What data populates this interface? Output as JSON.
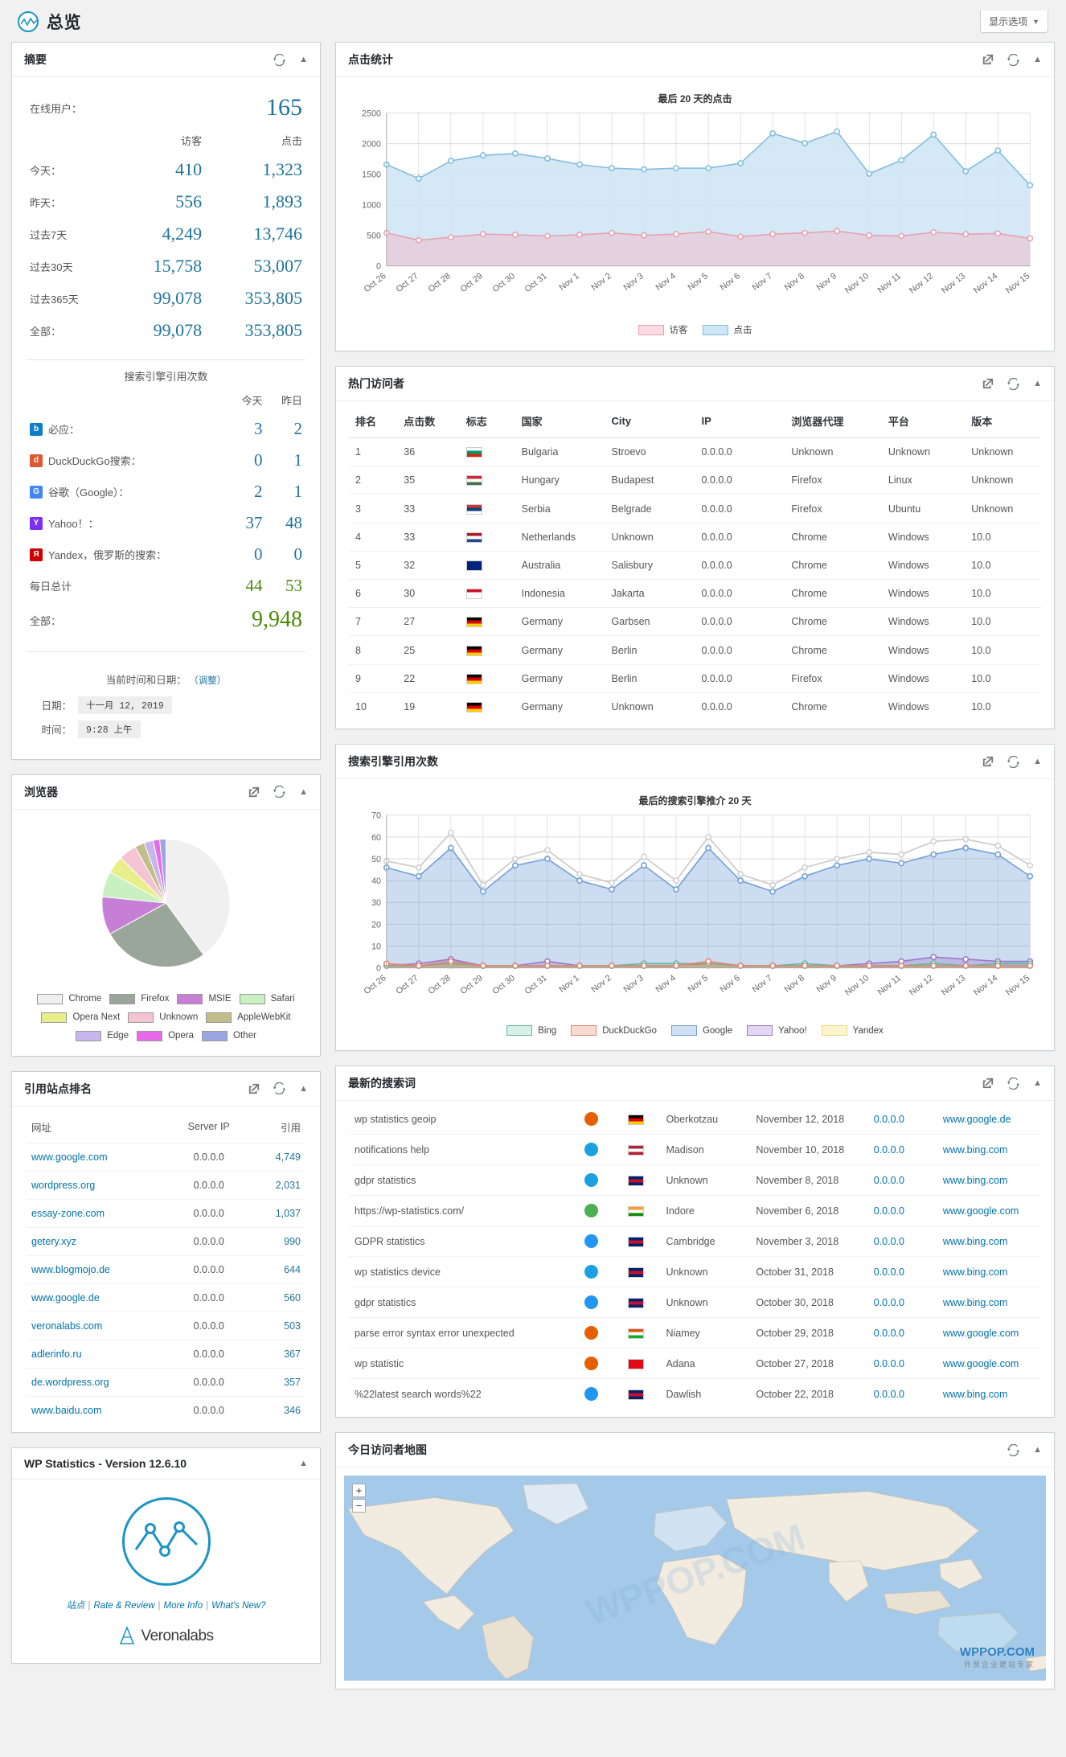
{
  "header": {
    "title": "总览",
    "screen_options": "显示选项",
    "logo_icon": "wp-statistics-logo-icon",
    "caret_icon": "chevron-down-icon"
  },
  "summary": {
    "title": "摘要",
    "refresh_icon": "refresh-icon",
    "collapse_icon": "chevron-up-icon",
    "online_label": "在线用户：",
    "online_value": "165",
    "col_visitors": "访客",
    "col_hits": "点击",
    "rows": [
      {
        "label": "今天：",
        "visitors": "410",
        "hits": "1,323"
      },
      {
        "label": "昨天：",
        "visitors": "556",
        "hits": "1,893"
      },
      {
        "label": "过去7天",
        "visitors": "4,249",
        "hits": "13,746"
      },
      {
        "label": "过去30天",
        "visitors": "15,758",
        "hits": "53,007"
      },
      {
        "label": "过去365天",
        "visitors": "99,078",
        "hits": "353,805"
      },
      {
        "label": "全部：",
        "visitors": "99,078",
        "hits": "353,805"
      }
    ],
    "search_caption": "搜索引擎引用次数",
    "se_col_today": "今天",
    "se_col_yesterday": "昨日",
    "search_engines": [
      {
        "name": "必应：",
        "icon": "bing-icon",
        "today": "3",
        "yesterday": "2"
      },
      {
        "name": "DuckDuckGo搜索：",
        "icon": "duckduckgo-icon",
        "today": "0",
        "yesterday": "1"
      },
      {
        "name": "谷歌（Google）：",
        "icon": "google-icon",
        "today": "2",
        "yesterday": "1"
      },
      {
        "name": "Yahoo！：",
        "icon": "yahoo-icon",
        "today": "37",
        "yesterday": "48"
      },
      {
        "name": "Yandex，俄罗斯的搜索：",
        "icon": "yandex-icon",
        "today": "0",
        "yesterday": "0"
      }
    ],
    "daily_total_label": "每日总计",
    "daily_total_today": "44",
    "daily_total_yesterday": "53",
    "all_label": "全部：",
    "all_value": "9,948",
    "datetime_caption": "当前时间和日期：",
    "datetime_adjust": "（调整）",
    "date_label": "日期：",
    "date_value": "十一月 12, 2019",
    "time_label": "时间：",
    "time_value": "9:28 上午"
  },
  "hits_panel": {
    "title": "点击统计",
    "external_icon": "external-link-icon",
    "refresh_icon": "refresh-icon",
    "collapse_icon": "chevron-up-icon"
  },
  "visitors_panel": {
    "title": "热门访问者",
    "external_icon": "external-link-icon",
    "refresh_icon": "refresh-icon",
    "collapse_icon": "chevron-up-icon",
    "columns": [
      "排名",
      "点击数",
      "标志",
      "国家",
      "City",
      "IP",
      "浏览器代理",
      "平台",
      "版本"
    ],
    "rows": [
      {
        "rank": "1",
        "hits": "36",
        "flag": "bg",
        "country": "Bulgaria",
        "city": "Stroevo",
        "ip": "0.0.0.0",
        "agent": "Unknown",
        "platform": "Unknown",
        "version": "Unknown"
      },
      {
        "rank": "2",
        "hits": "35",
        "flag": "hu",
        "country": "Hungary",
        "city": "Budapest",
        "ip": "0.0.0.0",
        "agent": "Firefox",
        "platform": "Linux",
        "version": "Unknown"
      },
      {
        "rank": "3",
        "hits": "33",
        "flag": "rs",
        "country": "Serbia",
        "city": "Belgrade",
        "ip": "0.0.0.0",
        "agent": "Firefox",
        "platform": "Ubuntu",
        "version": "Unknown"
      },
      {
        "rank": "4",
        "hits": "33",
        "flag": "nl",
        "country": "Netherlands",
        "city": "Unknown",
        "ip": "0.0.0.0",
        "agent": "Chrome",
        "platform": "Windows",
        "version": "10.0"
      },
      {
        "rank": "5",
        "hits": "32",
        "flag": "au",
        "country": "Australia",
        "city": "Salisbury",
        "ip": "0.0.0.0",
        "agent": "Chrome",
        "platform": "Windows",
        "version": "10.0"
      },
      {
        "rank": "6",
        "hits": "30",
        "flag": "id",
        "country": "Indonesia",
        "city": "Jakarta",
        "ip": "0.0.0.0",
        "agent": "Chrome",
        "platform": "Windows",
        "version": "10.0"
      },
      {
        "rank": "7",
        "hits": "27",
        "flag": "de",
        "country": "Germany",
        "city": "Garbsen",
        "ip": "0.0.0.0",
        "agent": "Chrome",
        "platform": "Windows",
        "version": "10.0"
      },
      {
        "rank": "8",
        "hits": "25",
        "flag": "de",
        "country": "Germany",
        "city": "Berlin",
        "ip": "0.0.0.0",
        "agent": "Chrome",
        "platform": "Windows",
        "version": "10.0"
      },
      {
        "rank": "9",
        "hits": "22",
        "flag": "de",
        "country": "Germany",
        "city": "Berlin",
        "ip": "0.0.0.0",
        "agent": "Firefox",
        "platform": "Windows",
        "version": "10.0"
      },
      {
        "rank": "10",
        "hits": "19",
        "flag": "de",
        "country": "Germany",
        "city": "Unknown",
        "ip": "0.0.0.0",
        "agent": "Chrome",
        "platform": "Windows",
        "version": "10.0"
      }
    ]
  },
  "browsers_panel": {
    "title": "浏览器",
    "external_icon": "external-link-icon",
    "refresh_icon": "refresh-icon",
    "collapse_icon": "chevron-up-icon"
  },
  "referrers_panel": {
    "title": "引用站点排名",
    "external_icon": "external-link-icon",
    "refresh_icon": "refresh-icon",
    "collapse_icon": "chevron-up-icon",
    "columns": [
      "网址",
      "Server IP",
      "引用"
    ],
    "rows": [
      {
        "site": "www.google.com",
        "ip": "0.0.0.0",
        "count": "4,749"
      },
      {
        "site": "wordpress.org",
        "ip": "0.0.0.0",
        "count": "2,031"
      },
      {
        "site": "essay-zone.com",
        "ip": "0.0.0.0",
        "count": "1,037"
      },
      {
        "site": "getery.xyz",
        "ip": "0.0.0.0",
        "count": "990"
      },
      {
        "site": "www.blogmojo.de",
        "ip": "0.0.0.0",
        "count": "644"
      },
      {
        "site": "www.google.de",
        "ip": "0.0.0.0",
        "count": "560"
      },
      {
        "site": "veronalabs.com",
        "ip": "0.0.0.0",
        "count": "503"
      },
      {
        "site": "adlerinfo.ru",
        "ip": "0.0.0.0",
        "count": "367"
      },
      {
        "site": "de.wordpress.org",
        "ip": "0.0.0.0",
        "count": "357"
      },
      {
        "site": "www.baidu.com",
        "ip": "0.0.0.0",
        "count": "346"
      }
    ]
  },
  "se_panel": {
    "title": "搜索引擎引用次数",
    "external_icon": "external-link-icon",
    "refresh_icon": "refresh-icon",
    "collapse_icon": "chevron-up-icon"
  },
  "words_panel": {
    "title": "最新的搜索词",
    "external_icon": "external-link-icon",
    "refresh_icon": "refresh-icon",
    "collapse_icon": "chevron-up-icon",
    "rows": [
      {
        "word": "wp statistics geoip",
        "browser": "firefox",
        "flag": "de",
        "city": "Oberkotzau",
        "date": "November 12, 2018",
        "ip": "0.0.0.0",
        "referrer": "www.google.de"
      },
      {
        "word": "notifications help",
        "browser": "ie",
        "flag": "us",
        "city": "Madison",
        "date": "November 10, 2018",
        "ip": "0.0.0.0",
        "referrer": "www.bing.com"
      },
      {
        "word": "gdpr statistics",
        "browser": "ie",
        "flag": "gb",
        "city": "Unknown",
        "date": "November 8, 2018",
        "ip": "0.0.0.0",
        "referrer": "www.bing.com"
      },
      {
        "word": "https://wp-statistics.com/",
        "browser": "chrome",
        "flag": "in",
        "city": "Indore",
        "date": "November 6, 2018",
        "ip": "0.0.0.0",
        "referrer": "www.google.com"
      },
      {
        "word": "GDPR statistics",
        "browser": "unknown",
        "flag": "gb",
        "city": "Cambridge",
        "date": "November 3, 2018",
        "ip": "0.0.0.0",
        "referrer": "www.bing.com"
      },
      {
        "word": "wp statistics device",
        "browser": "ie",
        "flag": "gb",
        "city": "Unknown",
        "date": "October 31, 2018",
        "ip": "0.0.0.0",
        "referrer": "www.bing.com"
      },
      {
        "word": "gdpr statistics",
        "browser": "unknown",
        "flag": "gb",
        "city": "Unknown",
        "date": "October 30, 2018",
        "ip": "0.0.0.0",
        "referrer": "www.bing.com"
      },
      {
        "word": "parse error syntax error unexpected",
        "browser": "firefox",
        "flag": "ne",
        "city": "Niamey",
        "date": "October 29, 2018",
        "ip": "0.0.0.0",
        "referrer": "www.google.com"
      },
      {
        "word": "wp statistic",
        "browser": "firefox",
        "flag": "tr",
        "city": "Adana",
        "date": "October 27, 2018",
        "ip": "0.0.0.0",
        "referrer": "www.google.com"
      },
      {
        "word": "%22latest search words%22",
        "browser": "unknown",
        "flag": "gb",
        "city": "Dawlish",
        "date": "October 22, 2018",
        "ip": "0.0.0.0",
        "referrer": "www.bing.com"
      }
    ]
  },
  "map_panel": {
    "title": "今日访问者地图",
    "refresh_icon": "refresh-icon",
    "collapse_icon": "chevron-up-icon",
    "zoom_in": "+",
    "zoom_out": "−",
    "watermark": "WPPOP.COM",
    "watermark_sub": "外贸企业建站专家"
  },
  "about_panel": {
    "title": "WP Statistics - Version 12.6.10",
    "collapse_icon": "chevron-up-icon",
    "logo_icon": "wp-statistics-logo-icon",
    "links": [
      "站点",
      "Rate & Review",
      "More Info",
      "What's New?"
    ],
    "vendor": "Veronalabs",
    "vendor_icon": "verona-labs-icon"
  },
  "chart_data": [
    {
      "type": "area",
      "title": "最后 20 天的点击",
      "xlabel": "",
      "ylabel": "",
      "ylim": [
        0,
        2500
      ],
      "yticks": [
        0,
        500,
        1000,
        1500,
        2000,
        2500
      ],
      "grid": true,
      "legend_position": "bottom",
      "categories": [
        "Oct 26",
        "Oct 27",
        "Oct 28",
        "Oct 29",
        "Oct 30",
        "Oct 31",
        "Nov 1",
        "Nov 2",
        "Nov 3",
        "Nov 4",
        "Nov 5",
        "Nov 6",
        "Nov 7",
        "Nov 8",
        "Nov 9",
        "Nov 10",
        "Nov 11",
        "Nov 12",
        "Nov 13",
        "Nov 14",
        "Nov 15"
      ],
      "series": [
        {
          "name": "访客",
          "color": "#e9a0ae",
          "fill": "#e4cede",
          "values": [
            540,
            420,
            470,
            520,
            510,
            490,
            510,
            540,
            500,
            520,
            560,
            480,
            520,
            540,
            570,
            500,
            490,
            550,
            520,
            530,
            450
          ]
        },
        {
          "name": "点击",
          "color": "#7fbde0",
          "fill": "#cfe6f4",
          "values": [
            1660,
            1430,
            1720,
            1810,
            1840,
            1760,
            1660,
            1600,
            1580,
            1600,
            1600,
            1680,
            2170,
            2010,
            2200,
            1510,
            1730,
            2150,
            1550,
            1890,
            1320
          ]
        }
      ]
    },
    {
      "type": "area",
      "title": "最后的搜索引擎推介 20 天",
      "xlabel": "",
      "ylabel": "",
      "ylim": [
        0,
        70
      ],
      "yticks": [
        0,
        10,
        20,
        30,
        40,
        50,
        60,
        70
      ],
      "grid": true,
      "legend_position": "bottom",
      "categories": [
        "Oct 26",
        "Oct 27",
        "Oct 28",
        "Oct 29",
        "Oct 30",
        "Oct 31",
        "Nov 1",
        "Nov 2",
        "Nov 3",
        "Nov 4",
        "Nov 5",
        "Nov 6",
        "Nov 7",
        "Nov 8",
        "Nov 9",
        "Nov 10",
        "Nov 11",
        "Nov 12",
        "Nov 13",
        "Nov 14",
        "Nov 15"
      ],
      "series": [
        {
          "name": "Bing",
          "color": "#58b9a3",
          "values": [
            1,
            1,
            2,
            1,
            1,
            1,
            1,
            1,
            2,
            2,
            2,
            1,
            1,
            2,
            1,
            1,
            1,
            2,
            1,
            2,
            2
          ]
        },
        {
          "name": "DuckDuckGo",
          "color": "#e8836b",
          "values": [
            2,
            1,
            3,
            1,
            1,
            1,
            1,
            1,
            1,
            1,
            3,
            1,
            1,
            1,
            1,
            1,
            1,
            1,
            1,
            1,
            1
          ]
        },
        {
          "name": "Google",
          "color": "#6f9fd8",
          "values": [
            46,
            42,
            55,
            35,
            47,
            50,
            40,
            36,
            47,
            36,
            55,
            40,
            35,
            42,
            47,
            50,
            48,
            52,
            55,
            52,
            42
          ]
        },
        {
          "name": "Yahoo!",
          "color": "#9a77c9",
          "values": [
            1,
            2,
            4,
            1,
            1,
            3,
            1,
            1,
            1,
            1,
            2,
            1,
            1,
            1,
            1,
            2,
            3,
            5,
            4,
            3,
            3
          ]
        },
        {
          "name": "Yandex",
          "color": "#efd77e",
          "values": [
            1,
            1,
            1,
            1,
            1,
            1,
            1,
            1,
            1,
            1,
            1,
            1,
            1,
            1,
            1,
            1,
            1,
            1,
            1,
            1,
            1
          ]
        }
      ],
      "overlay_series": {
        "name": "total",
        "color": "#cccccc",
        "values": [
          49,
          46,
          62,
          38,
          50,
          54,
          43,
          39,
          51,
          40,
          60,
          43,
          38,
          46,
          50,
          53,
          52,
          58,
          59,
          56,
          47
        ]
      }
    },
    {
      "type": "pie",
      "title": "浏览器",
      "legend_position": "bottom",
      "labels": [
        "Chrome",
        "Firefox",
        "MSIE",
        "Safari",
        "Opera Next",
        "Unknown",
        "AppleWebKit",
        "Edge",
        "Opera",
        "Other"
      ],
      "colors": [
        "#f0f0f0",
        "#9aa69a",
        "#c77fd6",
        "#c8f0c0",
        "#e8ee8a",
        "#f4c4d2",
        "#c3bd8c",
        "#c7b6ee",
        "#e86ae8",
        "#9aa6e0"
      ],
      "values": [
        38,
        24,
        9,
        6,
        5,
        5,
        3,
        3,
        2,
        5
      ]
    }
  ]
}
